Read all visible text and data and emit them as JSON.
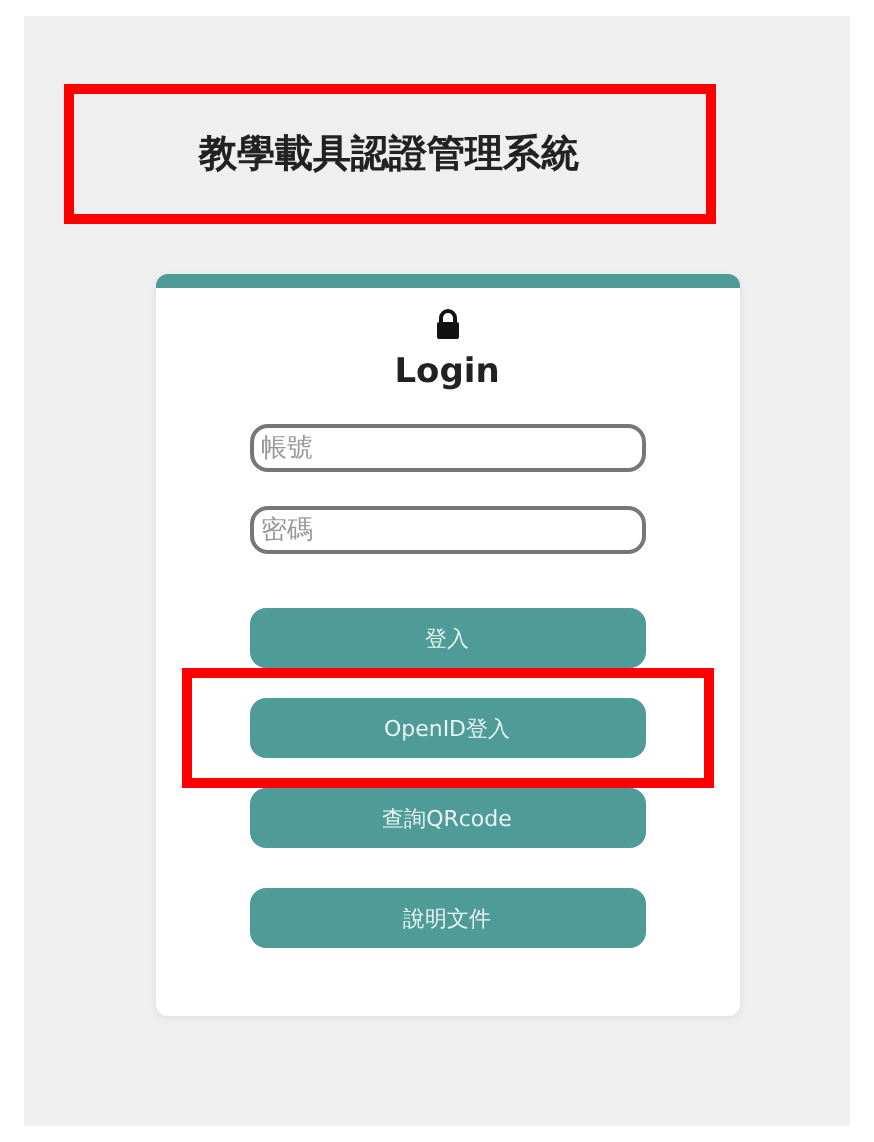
{
  "header": {
    "title": "教學載具認證管理系統",
    "highlighted": true
  },
  "login": {
    "heading": "Login",
    "fields": [
      {
        "placeholder": "帳號"
      },
      {
        "placeholder": "密碼"
      }
    ],
    "buttons": [
      {
        "label": "登入",
        "highlighted": false
      },
      {
        "label": "OpenID登入",
        "highlighted": true
      },
      {
        "label": "查詢QRcode",
        "highlighted": false
      },
      {
        "label": "說明文件",
        "highlighted": false
      }
    ]
  }
}
